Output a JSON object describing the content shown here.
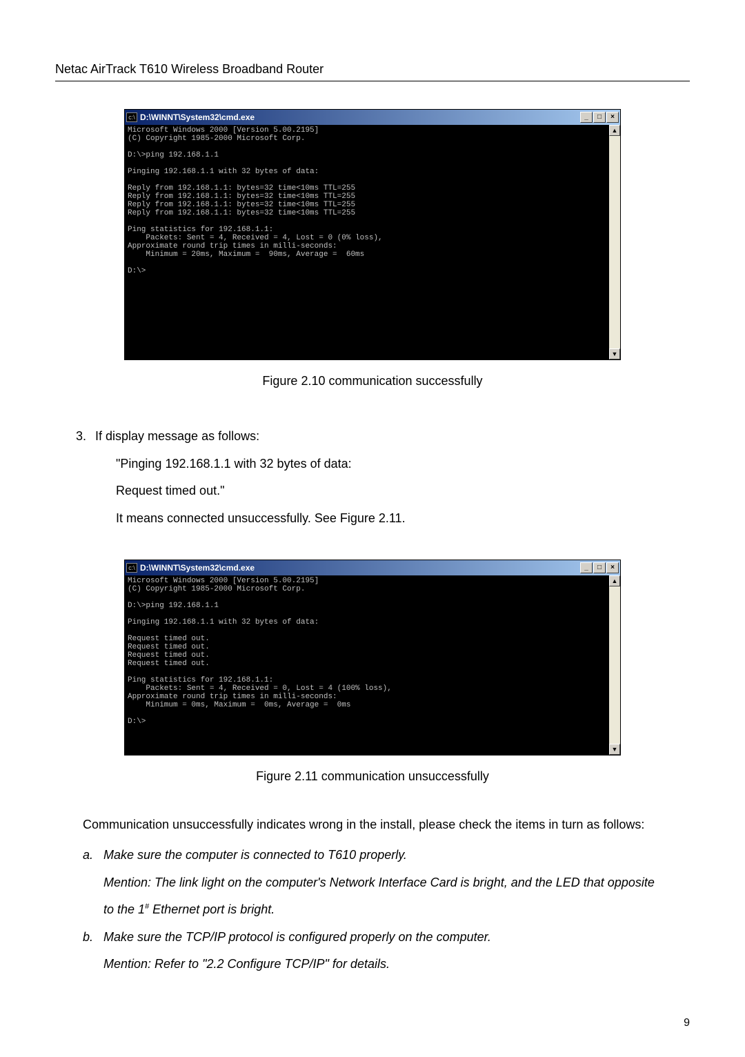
{
  "header": {
    "title": "Netac AirTrack T610 Wireless Broadband Router"
  },
  "figure1": {
    "window_title": "D:\\WINNT\\System32\\cmd.exe",
    "btn_min": "_",
    "btn_max": "□",
    "btn_close": "×",
    "scroll_up": "▲",
    "scroll_down": "▼",
    "body": "Microsoft Windows 2000 [Version 5.00.2195]\n(C) Copyright 1985-2000 Microsoft Corp.\n\nD:\\>ping 192.168.1.1\n\nPinging 192.168.1.1 with 32 bytes of data:\n\nReply from 192.168.1.1: bytes=32 time<10ms TTL=255\nReply from 192.168.1.1: bytes=32 time<10ms TTL=255\nReply from 192.168.1.1: bytes=32 time<10ms TTL=255\nReply from 192.168.1.1: bytes=32 time<10ms TTL=255\n\nPing statistics for 192.168.1.1:\n    Packets: Sent = 4, Received = 4, Lost = 0 (0% loss),\nApproximate round trip times in milli-seconds:\n    Minimum = 20ms, Maximum =  90ms, Average =  60ms\n\nD:\\>",
    "caption": "Figure 2.10 communication successfully"
  },
  "step3": {
    "num": "3.",
    "line1": "If display message as follows:",
    "line2": "\"Pinging 192.168.1.1 with 32 bytes of data:",
    "line3": "Request timed out.\"",
    "line4": "It means connected unsuccessfully. See Figure 2.11."
  },
  "figure2": {
    "window_title": "D:\\WINNT\\System32\\cmd.exe",
    "btn_min": "_",
    "btn_max": "□",
    "btn_close": "×",
    "scroll_up": "▲",
    "scroll_down": "▼",
    "body": "Microsoft Windows 2000 [Version 5.00.2195]\n(C) Copyright 1985-2000 Microsoft Corp.\n\nD:\\>ping 192.168.1.1\n\nPinging 192.168.1.1 with 32 bytes of data:\n\nRequest timed out.\nRequest timed out.\nRequest timed out.\nRequest timed out.\n\nPing statistics for 192.168.1.1:\n    Packets: Sent = 4, Received = 0, Lost = 4 (100% loss),\nApproximate round trip times in milli-seconds:\n    Minimum = 0ms, Maximum =  0ms, Average =  0ms\n\nD:\\>",
    "caption": "Figure 2.11 communication unsuccessfully"
  },
  "trouble": {
    "intro": "Communication unsuccessfully indicates wrong in the install, please check the items in turn as follows:",
    "a_letter": "a.",
    "a_line1": "Make sure the computer is connected to T610 properly.",
    "a_line2a": "Mention: The link light on the computer's Network Interface Card is bright, and the LED that opposite",
    "a_line2b_pre": "to the 1",
    "a_sup": "#",
    "a_line2b_post": " Ethernet port is bright.",
    "b_letter": "b.",
    "b_line1": "Make sure the TCP/IP protocol is configured properly on the computer.",
    "b_line2": "Mention: Refer to \"2.2 Configure TCP/IP\" for details."
  },
  "page_number": "9"
}
